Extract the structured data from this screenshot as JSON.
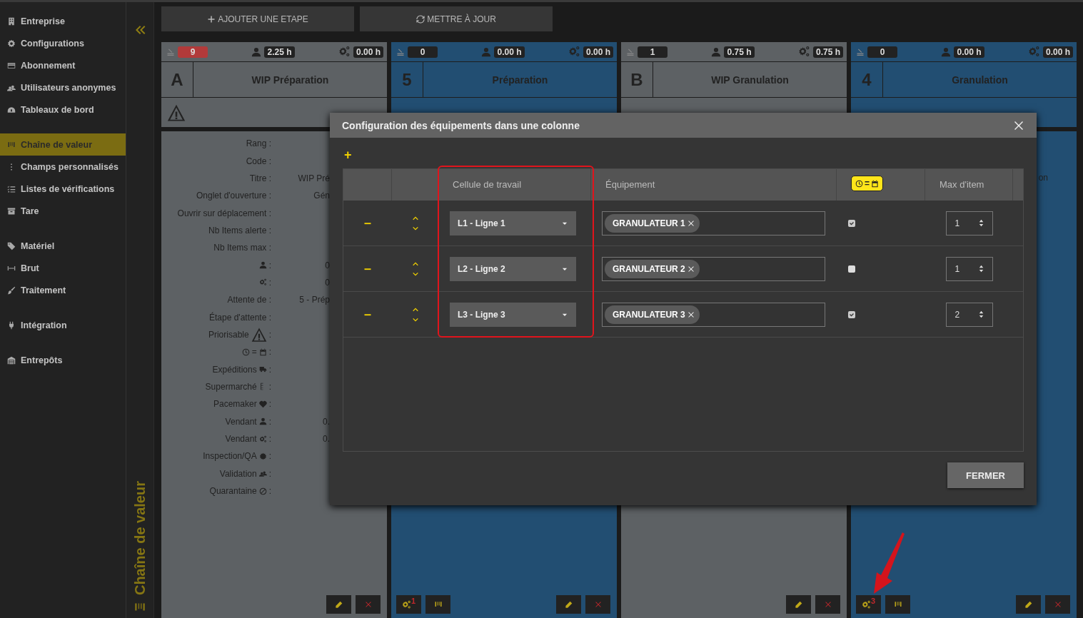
{
  "sidebar": {
    "sections": [
      [
        {
          "label": "Entreprise",
          "selected": false
        },
        {
          "label": "Configurations",
          "selected": false
        },
        {
          "label": "Abonnement",
          "selected": false
        },
        {
          "label": "Utilisateurs anonymes",
          "selected": false
        },
        {
          "label": "Tableaux de bord",
          "selected": false
        }
      ],
      [
        {
          "label": "Chaîne de valeur",
          "selected": true
        },
        {
          "label": "Champs personnalisés",
          "selected": false
        },
        {
          "label": "Listes de vérifications",
          "selected": false
        },
        {
          "label": "Tare",
          "selected": false
        }
      ],
      [
        {
          "label": "Matériel",
          "selected": false
        },
        {
          "label": "Brut",
          "selected": false
        },
        {
          "label": "Traitement",
          "selected": false
        }
      ],
      [
        {
          "label": "Intégration",
          "selected": false
        }
      ],
      [
        {
          "label": "Entrepôts",
          "selected": false
        }
      ]
    ]
  },
  "section_title": "Chaîne de valeur",
  "toolbar": [
    "AJOUTER UNE ETAPE",
    "METTRE À JOUR"
  ],
  "columns": [
    {
      "kind": "wip",
      "code": "A",
      "title": "WIP Préparation",
      "items": "9",
      "items_alert": true,
      "operator_time": "2.25 h",
      "machine_time": "0.00 h",
      "priority": true,
      "form": [
        {
          "kind": "text",
          "label": "Rang :"
        },
        {
          "kind": "text",
          "label": "Code :"
        },
        {
          "kind": "text",
          "label": "Titre :",
          "value": "WIP Pré"
        },
        {
          "kind": "text",
          "label": "Onglet d'ouverture :",
          "value": "Gén"
        },
        {
          "kind": "text",
          "label": "Ouvrir sur déplacement :"
        },
        {
          "kind": "text",
          "label": "Nb Items alerte :"
        },
        {
          "kind": "text",
          "label": "Nb Items max :"
        },
        {
          "kind": "icon",
          "after": ":",
          "value": "0"
        },
        {
          "kind": "icon",
          "after": ":",
          "value": "0"
        },
        {
          "kind": "text",
          "label": "Attente de :",
          "value": "5 - Prép"
        },
        {
          "kind": "text",
          "label": "Étape d'attente :"
        },
        {
          "kind": "icon",
          "label": "Priorisable",
          "after": ":"
        },
        {
          "kind": "equals",
          "label": "=",
          "after": ":"
        },
        {
          "kind": "icon",
          "label": "Expéditions",
          "after": ":"
        },
        {
          "kind": "icon",
          "label": "Supermarché",
          "after": ":"
        },
        {
          "kind": "icon",
          "label": "Pacemaker",
          "after": ":"
        },
        {
          "kind": "icon",
          "label": "Vendant",
          "after": ":",
          "value": "0."
        },
        {
          "kind": "icon",
          "label": "Vendant",
          "after": ":",
          "value": "0."
        },
        {
          "kind": "icon",
          "label": "Inspection/QA",
          "after": ":"
        },
        {
          "kind": "icon",
          "label": "Validation",
          "after": ":"
        },
        {
          "kind": "icon",
          "label": "Quarantaine",
          "after": ":"
        }
      ]
    },
    {
      "kind": "step",
      "code": "5",
      "title": "Préparation",
      "items": "0",
      "items_alert": false,
      "operator_time": "0.00 h",
      "machine_time": "0.00 h",
      "priority": false,
      "equipment_count": "1"
    },
    {
      "kind": "wip",
      "code": "B",
      "title": "WIP Granulation",
      "items": "1",
      "items_alert": false,
      "operator_time": "0.75 h",
      "machine_time": "0.75 h",
      "priority": false
    },
    {
      "kind": "step",
      "code": "4",
      "title": "Granulation",
      "items": "0",
      "items_alert": false,
      "operator_time": "0.00 h",
      "machine_time": "0.00 h",
      "priority": false,
      "equipment_count": "3",
      "body_text": "on"
    }
  ],
  "dialog": {
    "title": "Configuration des équipements dans une colonne",
    "add": "+",
    "columns": [
      "Cellule de travail",
      "Équipement",
      "=",
      "Max d'item"
    ],
    "rows": [
      {
        "cell": "L1 - Ligne 1",
        "equipment": [
          "GRANULATEUR 1"
        ],
        "checked": true,
        "max_items": "1"
      },
      {
        "cell": "L2 - Ligne 2",
        "equipment": [
          "GRANULATEUR 2"
        ],
        "checked": false,
        "max_items": "1"
      },
      {
        "cell": "L3 - Ligne 3",
        "equipment": [
          "GRANULATEUR 3"
        ],
        "checked": true,
        "max_items": "2"
      }
    ],
    "close_button": "FERMER"
  }
}
